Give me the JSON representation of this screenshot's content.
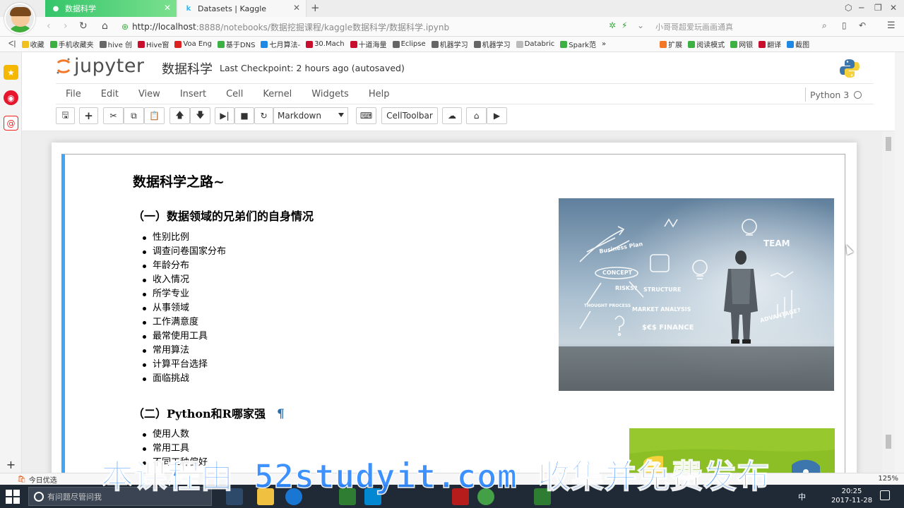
{
  "browser": {
    "tabs": [
      {
        "label": "数据科学",
        "active": true
      },
      {
        "label": "Datasets | Kaggle",
        "active": false
      }
    ],
    "new_tab_symbol": "+",
    "url_host": "http://localhost",
    "url_rest": ":8888/notebooks/数据挖掘课程/kaggle数据科学/数据科学.ipynb",
    "search_text": "小哥哥超爱玩画画通真",
    "bookmarks": [
      "收藏",
      "手机收藏夹",
      "hive 创",
      "Hive窗",
      "Voa Eng",
      "基于DNS",
      "七月算法-",
      "30.Mach",
      "十道海量",
      "Eclipse",
      "机器学习",
      "机器学习",
      "Databric",
      "Spark范"
    ],
    "bookmarks_right": [
      "扩展",
      "阅读模式",
      "网银",
      "翻译",
      "截图"
    ]
  },
  "jupyter": {
    "logo_text": "jupyter",
    "notebook_title": "数据科学",
    "checkpoint": "Last Checkpoint: 2 hours ago (autosaved)",
    "menu": [
      "File",
      "Edit",
      "View",
      "Insert",
      "Cell",
      "Kernel",
      "Widgets",
      "Help"
    ],
    "kernel_name": "Python 3",
    "cell_type": "Markdown",
    "celltoolbar_label": "CellToolbar"
  },
  "cell": {
    "title": "数据科学之路~",
    "section1": {
      "heading": "（一）数据领域的兄弟们的自身情况",
      "items": [
        "性别比例",
        "调查问卷国家分布",
        "年龄分布",
        "收入情况",
        "所学专业",
        "从事领域",
        "工作满意度",
        "最常使用工具",
        "常用算法",
        "计算平台选择",
        "面临挑战"
      ]
    },
    "section2": {
      "heading": "（二）Python和R哪家强",
      "pilcrow": "¶",
      "items": [
        "使用人数",
        "常用工具",
        "不同工种偏好"
      ]
    },
    "image_text": {
      "plan": "Business Plan",
      "concept": "CONCEPT",
      "risks": "RISKS?",
      "structure": "STRUCTURE",
      "market": "MARKET ANALYSIS",
      "finance": "$€$ FINANCE",
      "team": "TEAM",
      "advantage": "ADVANTAGE?",
      "thought": "THOUGHT PROCESS"
    }
  },
  "statusbar": {
    "left": "今日优选",
    "zoom": "125%"
  },
  "taskbar": {
    "search_placeholder": "有问题尽管问我",
    "ime": "中",
    "time": "20:25",
    "date": "2017-11-28"
  },
  "watermark": "本课程由 52studyit.com 收集并免费发布",
  "colors": {
    "cell_accent": "#42a5f5",
    "tab_active": "#35c56a",
    "watermark": "#2e89ff",
    "jupyter_orange": "#f37726"
  }
}
